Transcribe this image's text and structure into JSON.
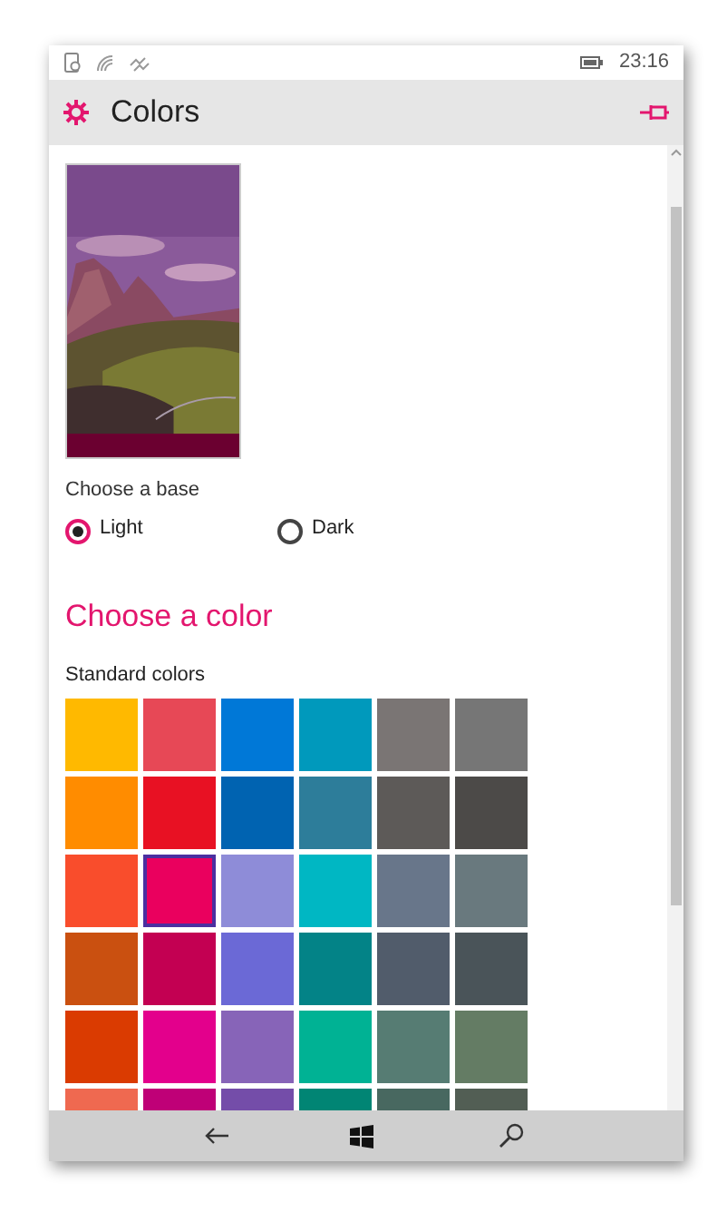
{
  "status_bar": {
    "time": "23:16"
  },
  "header": {
    "title": "Colors"
  },
  "base": {
    "label": "Choose a base",
    "options": [
      {
        "label": "Light",
        "selected": true
      },
      {
        "label": "Dark",
        "selected": false
      }
    ]
  },
  "accent": {
    "heading": "Choose a color",
    "subheading": "Standard colors",
    "swatches": [
      {
        "color": "#ffb900",
        "selected": false
      },
      {
        "color": "#e74856",
        "selected": false
      },
      {
        "color": "#0078d7",
        "selected": false
      },
      {
        "color": "#0099bc",
        "selected": false
      },
      {
        "color": "#7a7574",
        "selected": false
      },
      {
        "color": "#767676",
        "selected": false
      },
      {
        "color": "#ff8c00",
        "selected": false
      },
      {
        "color": "#e81123",
        "selected": false
      },
      {
        "color": "#0063b1",
        "selected": false
      },
      {
        "color": "#2d7d9a",
        "selected": false
      },
      {
        "color": "#5d5a58",
        "selected": false
      },
      {
        "color": "#4c4a48",
        "selected": false
      },
      {
        "color": "#f94d2c",
        "selected": false
      },
      {
        "color": "#ea005e",
        "selected": true
      },
      {
        "color": "#8e8cd8",
        "selected": false
      },
      {
        "color": "#00b7c3",
        "selected": false
      },
      {
        "color": "#68768a",
        "selected": false
      },
      {
        "color": "#69797e",
        "selected": false
      },
      {
        "color": "#ca5010",
        "selected": false
      },
      {
        "color": "#c30052",
        "selected": false
      },
      {
        "color": "#6b69d6",
        "selected": false
      },
      {
        "color": "#038387",
        "selected": false
      },
      {
        "color": "#515c6b",
        "selected": false
      },
      {
        "color": "#4a5459",
        "selected": false
      },
      {
        "color": "#da3b01",
        "selected": false
      },
      {
        "color": "#e3008c",
        "selected": false
      },
      {
        "color": "#8764b8",
        "selected": false
      },
      {
        "color": "#00b294",
        "selected": false
      },
      {
        "color": "#567c73",
        "selected": false
      },
      {
        "color": "#647c64",
        "selected": false
      },
      {
        "color": "#ef6950",
        "selected": false
      },
      {
        "color": "#bf0077",
        "selected": false
      },
      {
        "color": "#744da9",
        "selected": false
      },
      {
        "color": "#018574",
        "selected": false
      },
      {
        "color": "#486860",
        "selected": false
      },
      {
        "color": "#525e54",
        "selected": false
      }
    ]
  }
}
